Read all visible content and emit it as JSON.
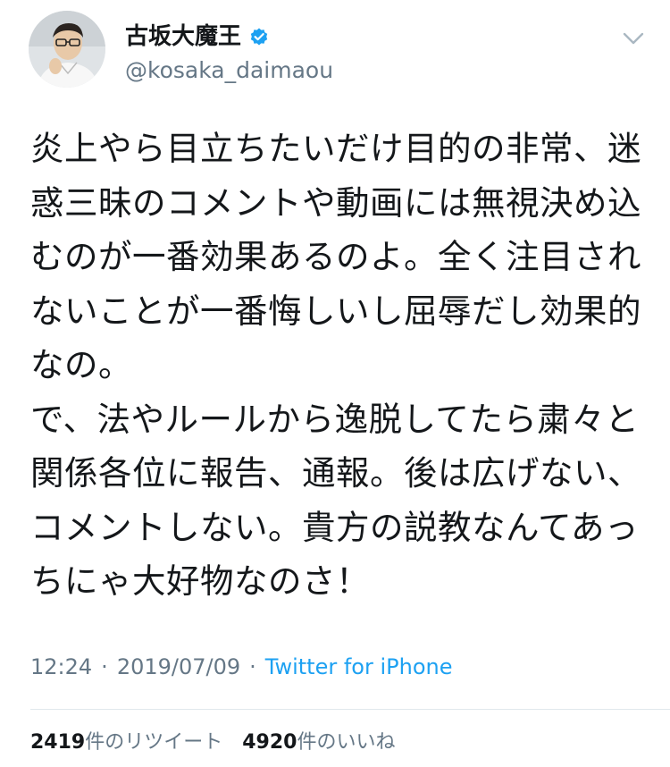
{
  "tweet": {
    "author": {
      "display_name": "古坂大魔王",
      "handle": "@kosaka_daimaou",
      "verified": true
    },
    "text": "炎上やら目立ちたいだけ目的の非常、迷惑三昧のコメントや動画には無視決め込むのが一番効果あるのよ。全く注目されないことが一番悔しいし屈辱だし効果的なの。\nで、法やルールから逸脱してたら粛々と関係各位に報告、通報。後は広げない、コメントしない。貴方の説教なんてあっちにゃ大好物なのさ！",
    "time": "12:24",
    "date": "2019/07/09",
    "separator": "·",
    "source": "Twitter for iPhone"
  },
  "stats": {
    "retweets_count": "2419",
    "retweets_label": "件のリツイート",
    "likes_count": "4920",
    "likes_label": "件のいいね"
  },
  "colors": {
    "text": "#14171a",
    "secondary": "#657786",
    "accent": "#1da1f2",
    "divider": "#e1e8ed"
  },
  "icons": {
    "verified": "verified-badge-icon",
    "menu": "chevron-down-icon",
    "avatar": "profile-avatar"
  }
}
